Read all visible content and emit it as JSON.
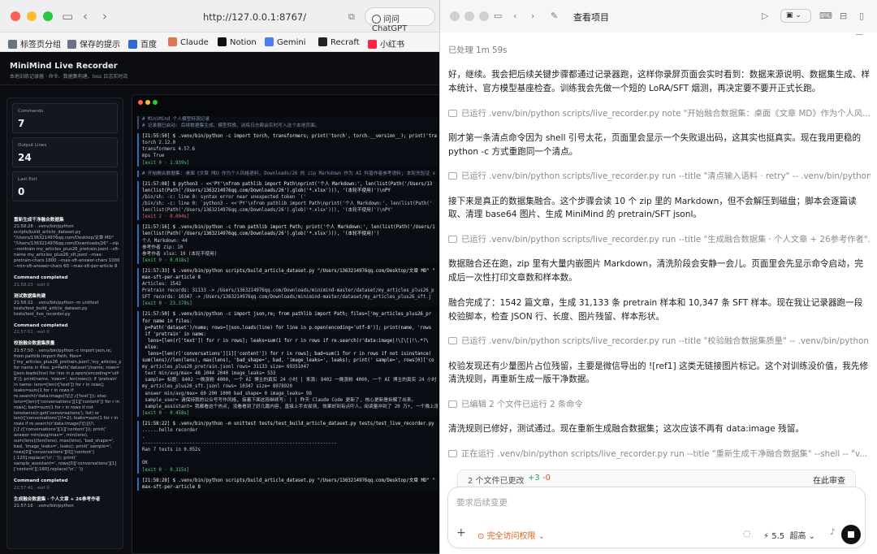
{
  "browser": {
    "url": "http://127.0.0.1:8767/",
    "ask_label": "问问 ChatGPT",
    "bookmarks": [
      {
        "label": "标签页分组",
        "color": "#6b7280"
      },
      {
        "label": "保存的提示",
        "color": "#6b7280"
      },
      {
        "label": "百度",
        "color": "#2f6bd8"
      },
      {
        "label": "Claude",
        "color": "#d97757"
      },
      {
        "label": "Notion",
        "color": "#111111"
      },
      {
        "label": "Gemini",
        "color": "#4b7cf0"
      },
      {
        "label": "Recraft",
        "color": "#222222"
      },
      {
        "label": "小红书",
        "color": "#ff2442"
      }
    ]
  },
  "recorder": {
    "title": "MiniMind Live Recorder",
    "subtitle": "本地训练记录器 · 命令、数据集构建、loss 日志实时流",
    "stats": [
      {
        "label": "Commands",
        "value": "7"
      },
      {
        "label": "Output Lines",
        "value": "24"
      },
      {
        "label": "Last Exit",
        "value": "0"
      }
    ],
    "log": [
      {
        "type": "h",
        "text": "重新生成干净融合数据集"
      },
      {
        "type": "x",
        "text": "21:58:28 · .venv/bin/python scripts/build_article_dataset.py \"/Users/1363214976qq.com/Desktop/文章 MD\" \"/Users/1363214976qq.com/Downloads/26\" --zip --nontrain my_articles_plus26_pretrain.jsonl --sft-name my_articles_plus26_sft.jsonl --max-pretrain-chars 1800 --max-sft-answer-chars 1000 --min-sft-answer-chars 60 --max-sft-per-article 8"
      },
      {
        "type": "h",
        "text": "Command completed"
      },
      {
        "type": "t",
        "text": "21:58:23 · exit 0"
      },
      {
        "type": "h",
        "text": "测试数据集构建"
      },
      {
        "type": "x",
        "text": "21:58:22 · .venv/bin/python -m unittest tests/test_build_article_dataset.py tests/test_live_recorder.py"
      },
      {
        "type": "h",
        "text": "Command completed"
      },
      {
        "type": "t",
        "text": "21:57:51 · exit 0"
      },
      {
        "type": "h",
        "text": "校验融合数据集质量"
      },
      {
        "type": "x",
        "text": "21:57:50 · .venv/bin/python -c import json,re; from pathlib import Path; files=['my_articles_plus26_pretrain.jsonl','my_articles_plus26_sft.jsonl']; for name in files: p=Path('dataset')/name; rows=[json.loads(line) for line in p.open(encoding='utf-8')]; print(name, 'rows=', len(rows)); if 'pretrain' in name: lens=[len(r['text']) for r in rows]; leaks=sum(1 for r in rows if re.search(r'data:image|!\\[\\]',r['text'])); else: lens=[len(r['conversations'][1]['content']) for r in rows]; bad=sum(1 for r in rows if not isinstance(r.get('conversations'), list) or len(r['conversations'])!=2); leaks=sum(1 for r in rows if re.search(r'data:image|!\\[\\]|\\!\\[\\]',r['conversations'][1]['content'])); print(' answer min/avg/max=', min(lens), sum(lens)//len(lens), max(lens), 'bad_shape=', bad, 'image_leaks=', leaks); print(' sample=', rows[0]['conversations'][0]['content'][:120].replace('\\n',' ')); print(' sample_assistant=', rows[0]['conversations'][1]['content'][:160].replace('\\n',' '))"
      },
      {
        "type": "h",
        "text": "Command completed"
      },
      {
        "type": "t",
        "text": "21:57:41 · exit 0"
      },
      {
        "type": "h",
        "text": "生成融合数据集 · 个人文章 + 26参考作者"
      },
      {
        "type": "x",
        "text": "21:57:16 · .venv/bin/python"
      }
    ],
    "terminal": [
      {
        "lines": [
          {
            "c": "cmt",
            "t": "# MiniMind 个人模型特调记录"
          },
          {
            "c": "cmt",
            "t": "# 记录器已启动: 后续数据集生成、模型转换、训练日志都会实时写入这个本地页面。"
          }
        ]
      },
      {
        "lines": [
          {
            "c": "cmd",
            "t": "[21:55:50] $ .venv/bin/python -c import torch, transformers; print('torch', torch.__version__); print('tra"
          },
          {
            "c": "",
            "t": "torch 2.12.0"
          },
          {
            "c": "",
            "t": "transformers 4.57.6"
          },
          {
            "c": "",
            "t": "mps True"
          },
          {
            "c": "ok",
            "t": "[exit 0 · 1.939s]"
          }
        ]
      },
      {
        "lines": [
          {
            "c": "cmt",
            "t": "# 开始融合数据集: 桌面《文章 MD》作为个人风格语料, Downloads/26 的 zip Markdown 作为 AI 科普作者参考语料; 本轮先验证 x"
          }
        ]
      },
      {
        "lines": [
          {
            "c": "cmd",
            "t": "[21:57:08] $ python3 - <<'PY'\\nfrom pathlib import Path\\nprint('个人 Markdown:', len(list(Path('/Users/13"
          },
          {
            "c": "cmd",
            "t": "len(list(Path('/Users/1363214976qq.com/Downloads/26').glob('*.xlsx'))), '(本轮不使用)')\\nPY"
          },
          {
            "c": "",
            "t": "/bin/sh: -c: line 0: syntax error near unexpected token `('"
          },
          {
            "c": "",
            "t": "/bin/sh: -c: line 0: `python3 - <<'PY'\\nfrom pathlib import Path\\nprint('个人 Markdown:', len(list(Path('"
          },
          {
            "c": "",
            "t": "len(list(Path('/Users/1363214976qq.com/Downloads/26').glob('*.xlsx'))), '(本轮不使用)')\\nPY'"
          },
          {
            "c": "er",
            "t": "[exit 2 · 0.004s]"
          }
        ]
      },
      {
        "lines": [
          {
            "c": "cmd",
            "t": "[21:57:16] $ .venv/bin/python -c from pathlib import Path; print('个人 Markdown:', len(list(Path('/Users/1"
          },
          {
            "c": "cmd",
            "t": "len(list(Path('/Users/1363214976qq.com/Downloads/26').glob('*.xlsx'))), '(本轮不使用)')"
          },
          {
            "c": "",
            "t": "个人 Markdown: 44"
          },
          {
            "c": "",
            "t": "参考作者 zip: 10"
          },
          {
            "c": "",
            "t": "参考作者 xlsx: 10 (本轮不使用)"
          },
          {
            "c": "ok",
            "t": "[exit 0 · 0.018s]"
          }
        ]
      },
      {
        "lines": [
          {
            "c": "cmd",
            "t": "[21:57:33] $ .venv/bin/python scripts/build_article_dataset.py \"/Users/1363214976qq.com/Desktop/文章 MD\" \""
          },
          {
            "c": "cmd",
            "t": "max-sft-per-article 8"
          },
          {
            "c": "",
            "t": "Articles: 1542"
          },
          {
            "c": "",
            "t": "Pretrain records: 31133 -> /Users/1363214976qq.com/Downloads/minimind-master/dataset/my_articles_plus26_p"
          },
          {
            "c": "",
            "t": "SFT records: 10347 -> /Users/1363214976qq.com/Downloads/minimind-master/dataset/my_articles_plus26_sft.j"
          },
          {
            "c": "ok",
            "t": "[exit 0 · 23.378s]"
          }
        ]
      },
      {
        "lines": [
          {
            "c": "cmd",
            "t": "[21:57:50] $ .venv/bin/python -c import json,re; from pathlib import Path; files=['my_articles_plus26_pr"
          },
          {
            "c": "cmd",
            "t": "for name in files:"
          },
          {
            "c": "cmd",
            "t": " p=Path('dataset')/name; rows=[json.loads(line) for line in p.open(encoding='utf-8')]; print(name, 'rows"
          },
          {
            "c": "cmd",
            "t": " if 'pretrain' in name:"
          },
          {
            "c": "cmd",
            "t": "  lens=[len(r['text']) for r in rows]; leaks=sum(1 for r in rows if re.search(r'data:image|!\\[\\[|!\\.*?\\"
          },
          {
            "c": "cmd",
            "t": " else:"
          },
          {
            "c": "cmd",
            "t": "  lens=[len(r['conversations'][1]['content']) for r in rows]; bad=sum(1 for r in rows if not isinstance("
          },
          {
            "c": "cmd",
            "t": "sum(lens)//len(lens), max(lens), 'bad_shape=', bad, 'image_leaks=', leaks); print(' sample=', rows[0]['co"
          },
          {
            "c": "",
            "t": "my_articles_plus26_pretrain.jsonl rows= 31133 size= 69351047"
          },
          {
            "c": "",
            "t": " text min/avg/max= 48 1044 2040 image_leaks= 533"
          },
          {
            "c": "",
            "t": " sample= 标题: 8402 一晚涨粉 4000, 一个 AI 博主的真实 24 小时 | 来源: 8402 一晚涨粉 4000, 一个 AI 博主的真实 24 小时"
          },
          {
            "c": "",
            "t": "my_articles_plus26_sft.jsonl rows= 10347 size= 8978920"
          },
          {
            "c": "",
            "t": " answer min/avg/max= 60 200 1000 bad_shape= 0 image_leaks= 98"
          },
          {
            "c": "",
            "t": " sample_user= 请保持我的公众号写作风格, 接着下面这段继续写: | | 昨天 Claude Code 更新了, 核心更新是拆解了出来。"
          },
          {
            "c": "",
            "t": " sample_assistant= 我都看这个热点, 没看看到了好几篇内容, 直接上手去尝测, 效果好到有点吓人。阅读量冲到了 20 万+, 一个晚上涨了"
          },
          {
            "c": "ok",
            "t": "[exit 0 · 0.458s]"
          }
        ]
      },
      {
        "lines": [
          {
            "c": "cmd",
            "t": "[21:58:22] $ .venv/bin/python -m unittest tests/test_build_article_dataset.py tests/test_live_recorder.py"
          },
          {
            "c": "",
            "t": "......hello recorder"
          },
          {
            "c": "",
            "t": "."
          },
          {
            "c": "",
            "t": "----------------------------------------------------------------------"
          },
          {
            "c": "",
            "t": "Ran 7 tests in 0.052s"
          },
          {
            "c": "",
            "t": ""
          },
          {
            "c": "",
            "t": "OK"
          },
          {
            "c": "ok",
            "t": "[exit 0 · 0.315s]"
          }
        ]
      },
      {
        "lines": [
          {
            "c": "cmd",
            "t": "[21:58:28] $ .venv/bin/python scripts/build_article_dataset.py \"/Users/1363214976qq.com/Desktop/文章 MD\" \""
          },
          {
            "c": "cmd",
            "t": "max-sft-per-article 8"
          }
        ]
      }
    ]
  },
  "chat": {
    "title": "查看项目",
    "meta": "已处理 1m 59s",
    "items": [
      {
        "type": "p",
        "text": "好，继续。我会把后续关键步骤都通过记录器跑，这样你录屏页面会实时看到：数据来源说明、数据集生成、样本统计、官方模型基座检查。训练我会先做一个短的 LoRA/SFT 烟测，再决定要不要开正式长跑。"
      },
      {
        "type": "run",
        "text": "已运行 .venv/bin/python scripts/live_recorder.py note \"开始融合数据集：桌面《文章 MD》作为个人风..."
      },
      {
        "type": "p",
        "text": "刚才第一条清点命令因为 shell 引号太花，页面里会显示一个失败退出码，这其实也挺真实。现在我用更稳的 python -c 方式重跑同一个清点。"
      },
      {
        "type": "run",
        "text": "已运行 .venv/bin/python scripts/live_recorder.py run --title \"清点输入语料 · retry\" -- .venv/bin/python ..."
      },
      {
        "type": "p",
        "text": "接下来是真正的数据集融合。这个步骤会读 10 个 zip 里的 Markdown，但不会解压到磁盘；脚本会逐篇读取、清理 base64 图片、生成 MiniMind 的 pretrain/SFT jsonl。"
      },
      {
        "type": "run",
        "text": "已运行 .venv/bin/python scripts/live_recorder.py run --title \"生成融合数据集 · 个人文章 + 26参考作者\"..."
      },
      {
        "type": "p",
        "text": "数据融合还在跑，zip 里有大量内嵌图片 Markdown，清洗阶段会安静一会儿。页面里会先显示命令启动，完成后一次性打印文章数和样本数。"
      },
      {
        "type": "p",
        "text": "融合完成了：1542 篇文章，生成 31,133 条 pretrain 样本和 10,347 条 SFT 样本。现在我让记录器跑一段校验脚本，检查 JSON 行、长度、图片残留、样本形状。"
      },
      {
        "type": "run",
        "text": "已运行 .venv/bin/python scripts/live_recorder.py run --title \"校验融合数据集质量\" -- .venv/bin/python ..."
      },
      {
        "type": "p",
        "text": "校验发现还有少量图片占位残留，主要是微信导出的 ![ref1] 这类无链接图片标记。这个对训练没价值，我先修清洗规则，再重新生成一版干净数据。"
      },
      {
        "type": "run",
        "text": "已编辑 2 个文件已运行 2 条命令"
      },
      {
        "type": "p",
        "text": "清洗规则已修好，测试通过。现在重新生成融合数据集；这次应该不再有 data:image 残留。"
      },
      {
        "type": "run",
        "text": "正在运行 .venv/bin/python scripts/live_recorder.py run --title \"重新生成干净融合数据集\" --shell -- \"v..."
      }
    ],
    "diff_label": "2 个文件已更改",
    "diff_plus": "+3",
    "diff_minus": "-0",
    "review_label": "在此审查",
    "composer_placeholder": "要求后续变更",
    "permission_label": "完全访问权限",
    "model_label": "5.5",
    "effort_label": "超高"
  }
}
